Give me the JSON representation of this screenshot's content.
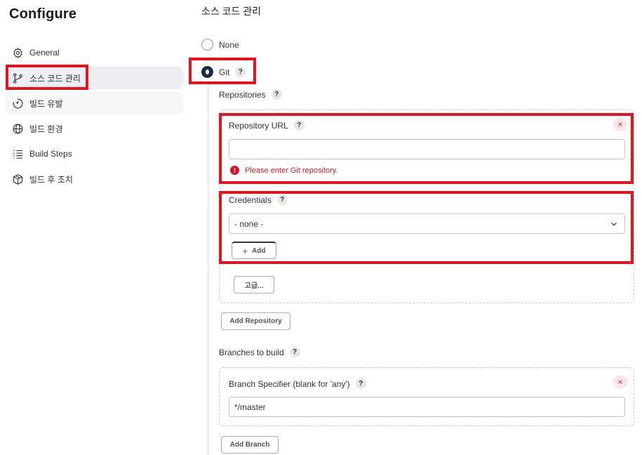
{
  "sidebar": {
    "title": "Configure",
    "items": [
      {
        "label": "General",
        "icon": "gear-icon"
      },
      {
        "label": "소스 코드 관리",
        "icon": "branch-icon"
      },
      {
        "label": "빌드 유발",
        "icon": "timer-icon"
      },
      {
        "label": "빌드 환경",
        "icon": "globe-icon"
      },
      {
        "label": "Build Steps",
        "icon": "list-icon"
      },
      {
        "label": "빌드 후 조치",
        "icon": "package-icon"
      }
    ]
  },
  "main": {
    "section_title": "소스 코드 관리",
    "scm_options": [
      {
        "label": "None",
        "selected": false
      },
      {
        "label": "Git",
        "selected": true
      }
    ],
    "help_glyph": "?",
    "repositories": {
      "label": "Repositories",
      "repository_url_label": "Repository URL",
      "repository_url_value": "",
      "error_text": "Please enter Git repository.",
      "error_glyph": "!",
      "credentials_label": "Credentials",
      "credentials_value": "- none -",
      "add_label": "Add",
      "add_glyph": "+",
      "advanced_label": "고급...",
      "close_glyph": "×"
    },
    "add_repository_label": "Add Repository",
    "branches": {
      "label": "Branches to build",
      "specifier_label": "Branch Specifier (blank for 'any')",
      "specifier_value": "*/master",
      "close_glyph": "×"
    },
    "add_branch_label": "Add Branch"
  },
  "colors": {
    "highlight": "#e8121c",
    "error": "#d0192b",
    "radio_selected": "#1a2b4a",
    "active_nav_bg": "#eceef2"
  }
}
